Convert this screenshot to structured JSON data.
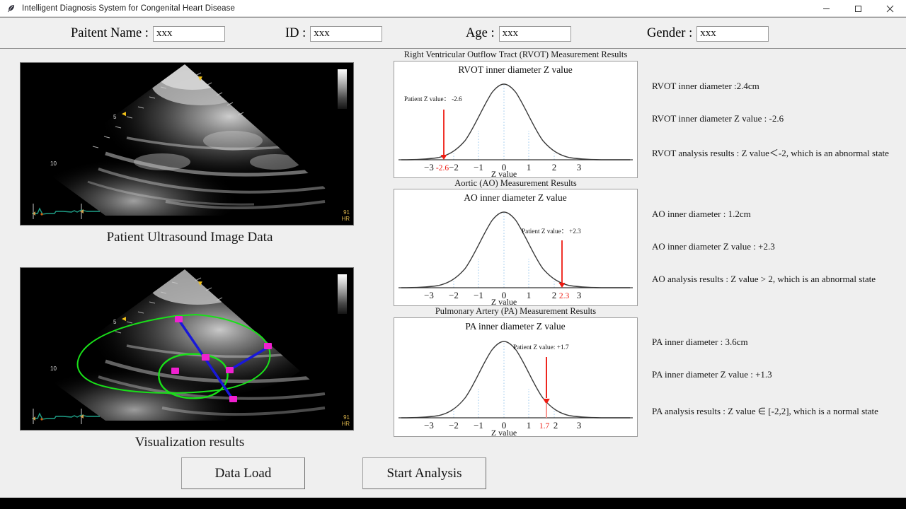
{
  "window": {
    "title": "Intelligent Diagnosis System for Congenital Heart Disease",
    "icon": "feather-icon",
    "minimize_label": "─",
    "maximize_label": "□",
    "close_label": "✕"
  },
  "header": {
    "fields": [
      {
        "label": "Paitent Name :",
        "value": "xxx",
        "placeholder": "xxx",
        "name": "patient-name"
      },
      {
        "label": "ID :",
        "value": "xxx",
        "placeholder": "xxx",
        "name": "patient-id"
      },
      {
        "label": "Age :",
        "value": "xxx",
        "placeholder": "xxx",
        "name": "patient-age"
      },
      {
        "label": "Gender :",
        "value": "xxx",
        "placeholder": "xxx",
        "name": "patient-gender"
      }
    ]
  },
  "left": {
    "image_caption": "Patient Ultrasound Image Data",
    "visualization_caption": "Visualization results",
    "ultrasound_overlay": {
      "heart_rate": "91",
      "heart_rate_label": "HR",
      "depth_marks": [
        "5",
        "10"
      ],
      "caret": "◄"
    }
  },
  "panels": [
    {
      "name": "rvot",
      "title": "Right Ventricular Outflow Tract (RVOT) Measurement Results",
      "chart_title": "RVOT inner diameter Z value",
      "annotation": "Patient Z value： -2.6",
      "marker_label": "-2.6",
      "results": [
        "RVOT inner diameter :2.4cm",
        "RVOT inner diameter Z value : -2.6",
        "RVOT analysis results : Z value＜-2, which is an abnormal state"
      ]
    },
    {
      "name": "ao",
      "title": "Aortic (AO) Measurement Results",
      "chart_title": "AO inner diameter Z value",
      "annotation": "Patient Z value：  +2.3",
      "marker_label": "2.3",
      "results": [
        "AO inner diameter : 1.2cm",
        "AO inner diameter Z value : +2.3",
        "AO analysis results : Z value > 2, which is an abnormal state"
      ]
    },
    {
      "name": "pa",
      "title": "Pulmonary Artery (PA) Measurement Results",
      "chart_title": "PA inner diameter Z value",
      "annotation": "Patient Z value: +1.7",
      "marker_label": "1.7",
      "results": [
        "PA inner diameter : 3.6cm",
        "PA inner diameter Z value : +1.3",
        "PA analysis results : Z value ∈  [-2,2], which is a normal state"
      ]
    }
  ],
  "buttons": {
    "data_load": "Data Load",
    "start_analysis": "Start Analysis"
  },
  "colors": {
    "marker_red": "#ee1b12",
    "gridline_blue": "#aed3ef",
    "curve_black": "#3a3a3a",
    "window_bg": "#efefef",
    "panel_white": "#ffffff",
    "contour_green": "#19e019",
    "measure_blue": "#1818d8",
    "vertex_magenta": "#f020d0"
  },
  "chart_data": [
    {
      "type": "line",
      "id": "rvot",
      "title": "RVOT inner diameter Z value",
      "xlabel": "Z value",
      "ylabel": "",
      "distribution": "standard-normal",
      "x": [
        -3,
        -2,
        -1,
        0,
        1,
        2,
        3
      ],
      "tick_labels": [
        "−3",
        "−2",
        "−1",
        "0",
        "1",
        "2",
        "3"
      ],
      "xlim": [
        -3.8,
        3.8
      ],
      "ylim": [
        0,
        0.44
      ],
      "gridlines_at": [
        -2,
        -1,
        0,
        1,
        2
      ],
      "grid": true,
      "legend": "none",
      "marker": {
        "z": -2.6,
        "label": "-2.6",
        "annotation": "Patient Z value： -2.6",
        "color": "#ee1b12"
      }
    },
    {
      "type": "line",
      "id": "ao",
      "title": "AO inner diameter Z value",
      "xlabel": "Z value",
      "ylabel": "",
      "distribution": "standard-normal",
      "x": [
        -3,
        -2,
        -1,
        0,
        1,
        2,
        3
      ],
      "tick_labels": [
        "−3",
        "−2",
        "−1",
        "0",
        "1",
        "2",
        "3"
      ],
      "xlim": [
        -3.8,
        3.8
      ],
      "ylim": [
        0,
        0.44
      ],
      "gridlines_at": [
        -2,
        -1,
        0,
        1,
        2
      ],
      "grid": true,
      "legend": "none",
      "marker": {
        "z": 2.3,
        "label": "2.3",
        "annotation": "Patient Z value：  +2.3",
        "color": "#ee1b12"
      }
    },
    {
      "type": "line",
      "id": "pa",
      "title": "PA inner diameter Z value",
      "xlabel": "Z value",
      "ylabel": "",
      "distribution": "standard-normal",
      "x": [
        -3,
        -2,
        -1,
        0,
        1,
        2,
        3
      ],
      "tick_labels": [
        "−3",
        "−2",
        "−1",
        "0",
        "1",
        "2",
        "3"
      ],
      "xlim": [
        -3.8,
        3.8
      ],
      "ylim": [
        0,
        0.44
      ],
      "gridlines_at": [
        -2,
        -1,
        0,
        1,
        2
      ],
      "grid": true,
      "legend": "none",
      "marker": {
        "z": 1.7,
        "label": "1.7",
        "annotation": "Patient Z value: +1.7",
        "color": "#ee1b12"
      }
    }
  ]
}
